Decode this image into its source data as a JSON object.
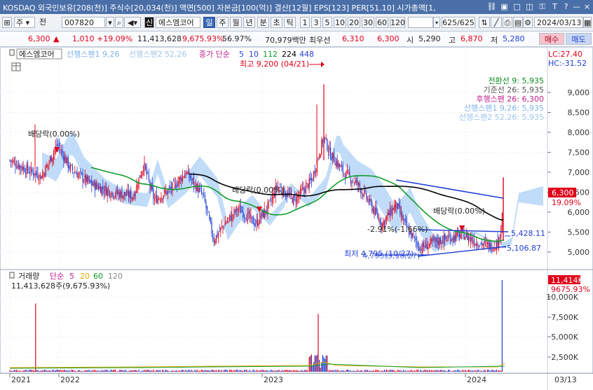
{
  "titlebar": {
    "text": "KOSDAQ 외국인보유[208(천)] 주식수[20,034(천)] 액면[500] 자본금[100(억)] 결산[12월] EPS[123] PER[51.10] 시가총액[1,"
  },
  "toolbar": {
    "market_select": "주",
    "market_label": "전",
    "code": "007820",
    "stock_name": "에스엠코어",
    "shin": "신",
    "periods": [
      "일",
      "주",
      "월",
      "년",
      "분",
      "초",
      "틱"
    ],
    "active_period": "일",
    "intervals": [
      "1",
      "3",
      "5",
      "10",
      "20",
      "30",
      "60",
      "120"
    ],
    "count": "625/625",
    "date": "2024/03/13"
  },
  "quote": {
    "price": "6,300",
    "change": "1,010",
    "change_pct": "+19.09%",
    "volume": "11,413,628",
    "volume_pct": "9,675.93%",
    "ratio": "56.97%",
    "amount": "70,979백만",
    "best_ask_label": "최우선",
    "best_ask": "6,310",
    "best_bid": "6,300",
    "open_label": "시",
    "open": "5,290",
    "high_label": "고",
    "high": "6,870",
    "low_label": "저",
    "low": "5,280",
    "buy_label": "매수",
    "sell_label": "매도"
  },
  "legend": {
    "name": "에스엠코어",
    "items": [
      {
        "text": "선행스팬1 9,26",
        "color": "#7fb2ea"
      },
      {
        "text": "선행스팬2 52,26",
        "color": "#9ec3ec"
      },
      {
        "text": "종가 단순",
        "color": "#c0208c"
      },
      {
        "text": "5",
        "color": "#2a42d8"
      },
      {
        "text": "10",
        "color": "#2a42d8"
      },
      {
        "text": "112",
        "color": "#119d2a"
      },
      {
        "text": "224",
        "color": "#000000"
      },
      {
        "text": "448",
        "color": "#2a42d8"
      }
    ],
    "lc": "LC:27.40",
    "hc": "HC:-31.52"
  },
  "ichimoku_legend": [
    {
      "text": "전환선 9: 5,935",
      "color": "#0a8c1f"
    },
    {
      "text": "기준선 26: 5,935",
      "color": "#555555"
    },
    {
      "text": "후행스팬 26: 6,300",
      "color": "#c0208c"
    },
    {
      "text": "선행스팬1 9,26: 5,935",
      "color": "#7fb2ea"
    },
    {
      "text": "선행스팬2 52,26: 5,935",
      "color": "#9ec3ec"
    }
  ],
  "annotations": {
    "high": "최고 9,200 (04/21)",
    "low": "최저 4,795 (10/27)",
    "low_overlap": "4,795(3,10/27)",
    "div1": "배당락(0.00%)",
    "div2": "배당락(0.00%)",
    "div3": "배당락(0.00%)",
    "fib": "-2.91%(-1.66%)",
    "trend1": "5,428.11",
    "trend2": "5,106.87"
  },
  "price_axis": {
    "ticks": [
      "9,000",
      "8,500",
      "8,000",
      "7,500",
      "7,000",
      "6,500",
      "6,000",
      "5,500",
      "5,000"
    ],
    "current": "6,300",
    "current_pct": "19.09%"
  },
  "volume_pane": {
    "title": "거래량",
    "legend": [
      {
        "text": "단순",
        "color": "#c0208c"
      },
      {
        "text": "5",
        "color": "#c0208c"
      },
      {
        "text": "20",
        "color": "#e0a800"
      },
      {
        "text": "60",
        "color": "#119d2a"
      },
      {
        "text": "120",
        "color": "#888888"
      }
    ],
    "value_text": "11,413,628주(9,675.93%)",
    "axis": [
      "10,000K",
      "7,500K",
      "5,000K",
      "2,500K"
    ],
    "current": "11,414K",
    "current_pct": "9675.93%"
  },
  "date_axis": [
    "2021",
    "2022",
    "2023",
    "2024",
    "03/13"
  ],
  "colors": {
    "up": "#e0001a",
    "down": "#1f3fd6",
    "cloud": "#8ec0f2",
    "ma112": "#119d2a",
    "ma224": "#000000",
    "titlebar": "#4a6fa8"
  }
}
